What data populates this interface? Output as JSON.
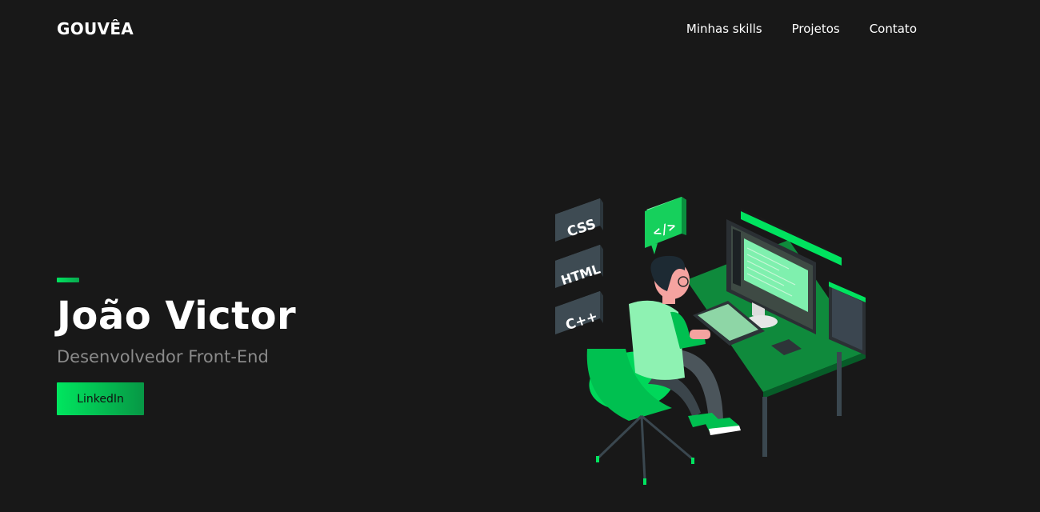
{
  "header": {
    "logo": "GOUVÊA",
    "nav": [
      {
        "label": "Minhas skills"
      },
      {
        "label": "Projetos"
      },
      {
        "label": "Contato"
      }
    ]
  },
  "hero": {
    "name": "João Victor",
    "role": "Desenvolvedor Front-End",
    "cta_label": "LinkedIn"
  },
  "illustration": {
    "tags": [
      "CSS",
      "HTML",
      "C++"
    ],
    "bubble_text": "</>"
  },
  "colors": {
    "background": "#181818",
    "accent": "#00e35f",
    "accent_dark": "#079745",
    "muted_text": "#8a8a8a"
  }
}
